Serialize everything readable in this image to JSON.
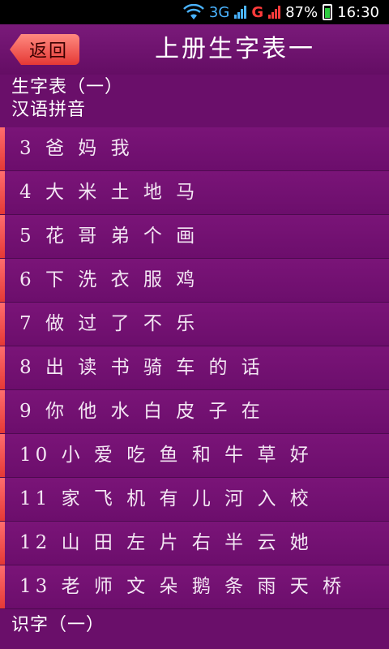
{
  "status_bar": {
    "network_3g": "3G",
    "network_g": "G",
    "battery": "87%",
    "time": "16:30",
    "icons": [
      "wifi-icon",
      "signal-icon",
      "battery-charging-icon"
    ]
  },
  "header": {
    "back_label": "返回",
    "title": "上册生字表一"
  },
  "section_top": {
    "line1": "生字表（一）",
    "line2": "汉语拼音"
  },
  "items": [
    {
      "label": "3 爸 妈 我"
    },
    {
      "label": "4 大 米 土 地 马"
    },
    {
      "label": "5 花 哥 弟 个 画"
    },
    {
      "label": "6 下 洗 衣 服 鸡"
    },
    {
      "label": "7 做 过 了 不 乐"
    },
    {
      "label": "8 出 读 书 骑 车 的 话"
    },
    {
      "label": "9 你 他 水 白 皮 子 在"
    },
    {
      "label": "10 小 爱 吃 鱼 和 牛 草 好"
    },
    {
      "label": "11 家 飞 机 有 儿 河 入 校"
    },
    {
      "label": "12 山 田 左 片 右 半 云 她"
    },
    {
      "label": "13 老 师 文 朵 鹅 条 雨 天 桥"
    }
  ],
  "section_bottom": {
    "line1": "识字（一）"
  },
  "colors": {
    "background": "#6a0f6a",
    "accent": "#e53935",
    "text": "#ffffff"
  }
}
